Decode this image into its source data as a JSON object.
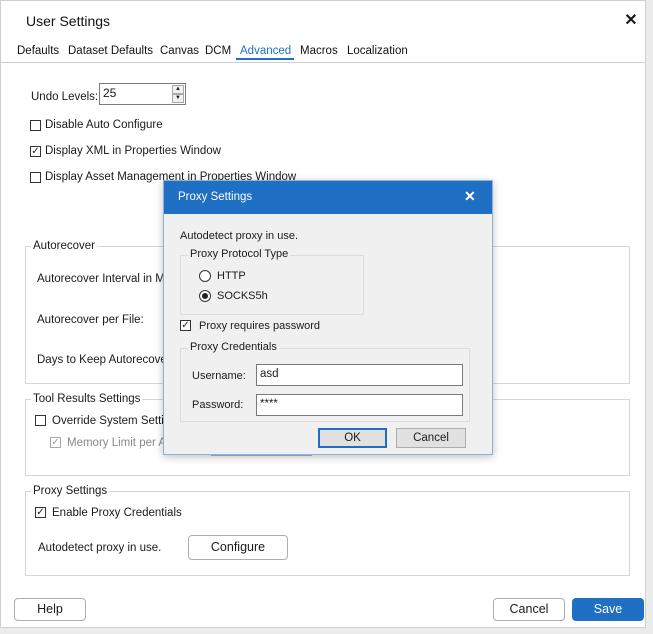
{
  "window": {
    "title": "User Settings"
  },
  "tabs": [
    "Defaults",
    "Dataset Defaults",
    "Canvas",
    "DCM",
    "Advanced",
    "Macros",
    "Localization"
  ],
  "active_tab": "Advanced",
  "undo": {
    "label": "Undo Levels:",
    "value": "25"
  },
  "checkboxes": {
    "disable_auto_configure": {
      "label": "Disable Auto Configure",
      "checked": false
    },
    "display_xml": {
      "label": "Display XML in Properties Window",
      "checked": true
    },
    "display_asset": {
      "label": "Display Asset Management in Properties Window",
      "checked": false
    }
  },
  "autorecover": {
    "title": "Autorecover",
    "interval_label": "Autorecover Interval in M",
    "per_file_label": "Autorecover per File:",
    "days_label": "Days to Keep Autorecove"
  },
  "tool_results": {
    "title": "Tool Results Settings",
    "override_label": "Override System Settin",
    "memory_label": "Memory Limit per A"
  },
  "proxy_settings": {
    "title": "Proxy Settings",
    "enable_label": "Enable Proxy Credentials",
    "autodetect_label": "Autodetect proxy in use.",
    "configure_label": "Configure"
  },
  "footer": {
    "help": "Help",
    "cancel": "Cancel",
    "save": "Save"
  },
  "proxy_dialog": {
    "title": "Proxy Settings",
    "autodetect": "Autodetect proxy in use.",
    "protocol_group": "Proxy Protocol Type",
    "http_label": "HTTP",
    "socks_label": "SOCKS5h",
    "selected_protocol": "SOCKS5h",
    "requires_password_label": "Proxy requires password",
    "credentials_group": "Proxy Credentials",
    "username_label": "Username:",
    "username_value": "asd",
    "password_label": "Password:",
    "password_value": "****",
    "ok": "OK",
    "cancel": "Cancel"
  },
  "colors": {
    "accent": "#1f6fc5",
    "dialog_bg": "#f0f0f0"
  }
}
